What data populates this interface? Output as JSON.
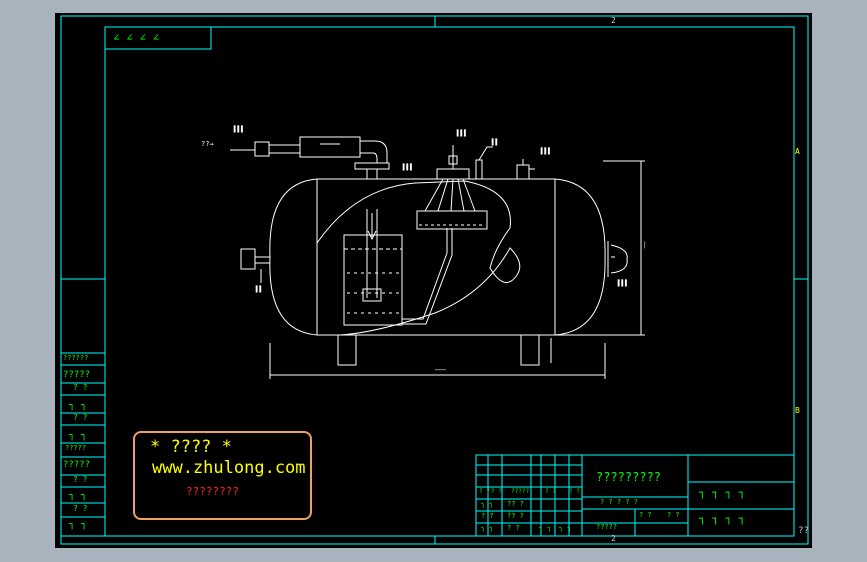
{
  "sheet": {
    "top_zone": "2",
    "bottom_zone": "2",
    "right_zone_upper": "A",
    "right_zone_lower": "B",
    "corner_mark": "??",
    "top_left_code": "∠ ∠ ∠ ∠"
  },
  "callouts": {
    "inlet_left": "??→",
    "valve_left": "▐▐▐",
    "center_top": "▐▐▐",
    "center_right": "▐▐",
    "right_top": "▐▐▐",
    "tank_left_fitting": "▐▐",
    "tank_right_head": "▐▐▐",
    "height_dim": "│",
    "width_dim": "───"
  },
  "left_strip": {
    "cells": [
      "??????",
      "?????",
      "? ?",
      "┐ ┐",
      "? ?",
      "┐ ┐",
      "?????",
      "?????",
      "? ?",
      "┐ ┐",
      "? ?",
      "┐ ┐"
    ]
  },
  "watermark": {
    "line1": "* ???? *",
    "line2": "www.zhulong.com",
    "line3": "????????"
  },
  "title_block": {
    "title": "?????????",
    "sub_labels": [
      "? ?",
      "? ?",
      "??",
      "?????",
      "? ?",
      "?? ??",
      "? ?",
      "? ?"
    ],
    "bottom_labels": [
      "?????",
      "? ?",
      "? ?"
    ],
    "mid_row": "? ? ? ? ?",
    "right_top": "┐ ┐ ┐ ┐",
    "right_bottom": "┐ ┐ ┐ ┐",
    "small_rows": [
      "┐ ┐",
      "?? ?",
      "? ?",
      "?? ?"
    ]
  },
  "colors": {
    "border": "#00ffff",
    "drawing": "#ffffff",
    "text_green": "#00ff00",
    "text_yellow": "#ffff00",
    "watermark_border": "#f0a060",
    "watermark_red": "#ff2020"
  }
}
